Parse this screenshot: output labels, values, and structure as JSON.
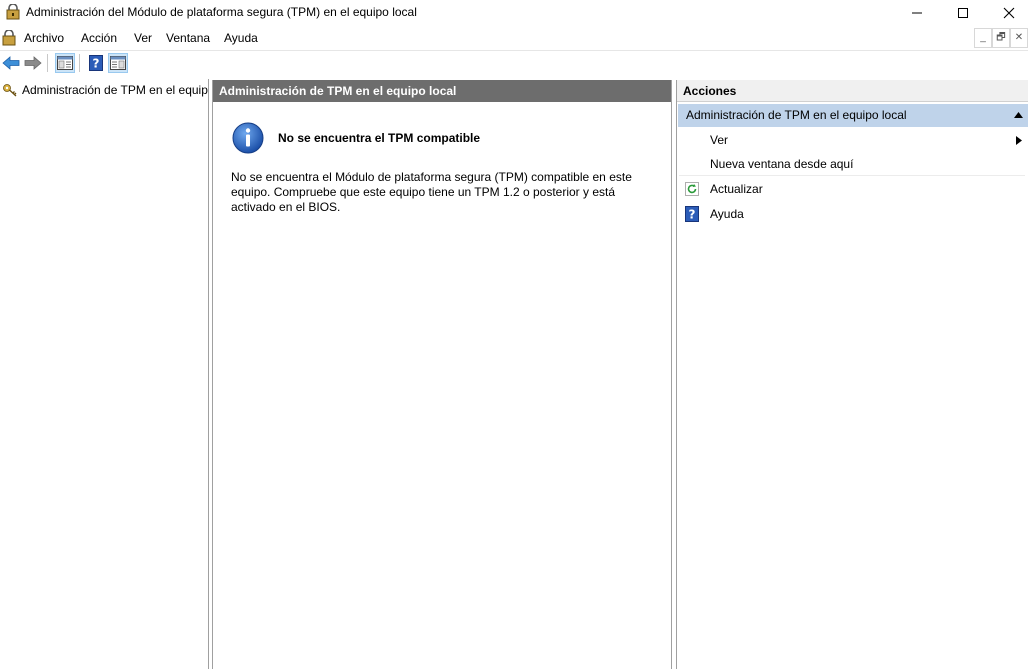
{
  "window": {
    "title": "Administración del Módulo de plataforma segura (TPM) en el equipo local",
    "icon": "tpm-snapin-icon"
  },
  "menu": {
    "items": [
      "Archivo",
      "Acción",
      "Ver",
      "Ventana",
      "Ayuda"
    ]
  },
  "mdi_buttons": [
    "_",
    "🗗",
    "✕"
  ],
  "toolbar": {
    "buttons": [
      "back-arrow-icon",
      "forward-arrow-icon",
      "show-hide-console-tree-icon",
      "help-icon",
      "show-hide-action-pane-icon"
    ]
  },
  "tree": {
    "root_label": "Administración de TPM en el equipo local"
  },
  "center": {
    "header": "Administración de TPM en el equipo local",
    "info_title": "No se encuentra el TPM compatible",
    "info_body": "No se encuentra el Módulo de plataforma segura (TPM) compatible en este equipo. Compruebe que este equipo tiene un TPM 1.2 o posterior y está activado en el BIOS."
  },
  "actions": {
    "header": "Acciones",
    "group_label": "Administración de TPM en el equipo local",
    "items": [
      {
        "label": "Ver",
        "icon": "",
        "submenu": true
      },
      {
        "label": "Nueva ventana desde aquí",
        "icon": "",
        "submenu": false
      },
      {
        "label": "Actualizar",
        "icon": "refresh-icon",
        "submenu": false
      },
      {
        "label": "Ayuda",
        "icon": "help-icon",
        "submenu": false
      }
    ]
  },
  "colors": {
    "center_header_bg": "#6d6d6d",
    "actions_group_bg": "#bfd3ea",
    "info_icon_blue": "#1f5fbf"
  }
}
